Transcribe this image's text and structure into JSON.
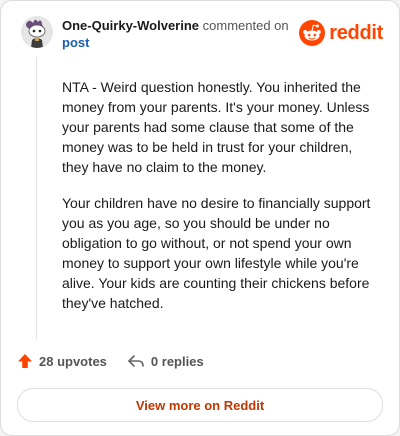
{
  "comment": {
    "author": "One-Quirky-Wolverine",
    "action_text": "commented on",
    "target_link": "post",
    "paragraphs": [
      "NTA - Weird question honestly. You inherited the money from your parents. It's your money. Unless your parents had some clause that some of the money was to be held in trust for your children, they have no claim to the money.",
      "Your children have no desire to financially support you as you age, so you should be under no obligation to go without, or not spend your own money to support your own lifestyle while you're alive. Your kids are counting their chickens before they've hatched."
    ]
  },
  "brand": {
    "name": "reddit",
    "icon": "reddit-logo-icon",
    "color": "#ff4500"
  },
  "footer": {
    "upvotes": "28 upvotes",
    "upvote_icon": "upvote-arrow-icon",
    "upvote_color": "#ff4500",
    "replies": "0 replies",
    "reply_icon": "reply-arrow-icon"
  },
  "actions": {
    "view_more": "View more on Reddit"
  }
}
